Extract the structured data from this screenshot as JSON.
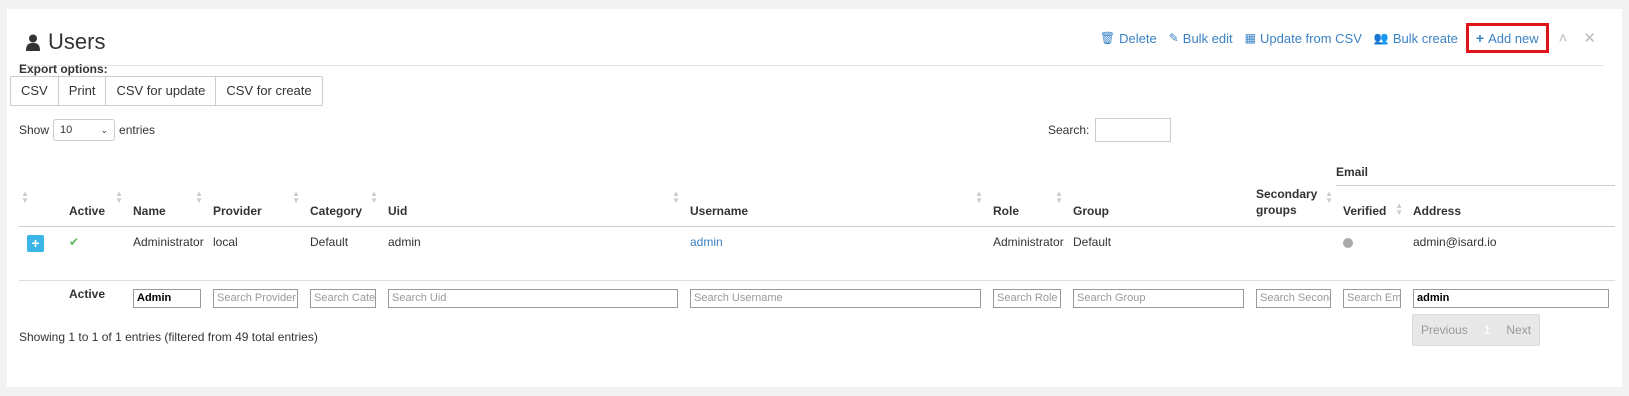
{
  "title": "Users",
  "toolbar": {
    "delete": "Delete",
    "bulk_edit": "Bulk edit",
    "update_csv": "Update from CSV",
    "bulk_create": "Bulk create",
    "add_new": "Add new"
  },
  "export": {
    "label": "Export options:",
    "csv": "CSV",
    "print": "Print",
    "csv_update": "CSV for update",
    "csv_create": "CSV for create"
  },
  "length": {
    "show": "Show",
    "value": "10",
    "entries": "entries"
  },
  "search": {
    "label": "Search:"
  },
  "headers": {
    "active": "Active",
    "name": "Name",
    "provider": "Provider",
    "category": "Category",
    "uid": "Uid",
    "username": "Username",
    "role": "Role",
    "group": "Group",
    "secondary": "Secondary groups",
    "email": "Email",
    "verified": "Verified",
    "address": "Address"
  },
  "row": {
    "name": "Administrator",
    "provider": "local",
    "category": "Default",
    "uid": "admin",
    "username": "admin",
    "role": "Administrator",
    "group": "Default",
    "address": "admin@isard.io"
  },
  "filters": {
    "active": "Active",
    "name": "Admin",
    "provider": "Search Provider",
    "category": "Search Category",
    "uid": "Search Uid",
    "username": "Search Username",
    "role": "Search Role",
    "group": "Search Group",
    "secondary": "Search Secondary groups",
    "verified": "Search Email verified",
    "address": "admin"
  },
  "info": "Showing 1 to 1 of 1 entries (filtered from 49 total entries)",
  "pager": {
    "previous": "Previous",
    "page": "1",
    "next": "Next"
  }
}
